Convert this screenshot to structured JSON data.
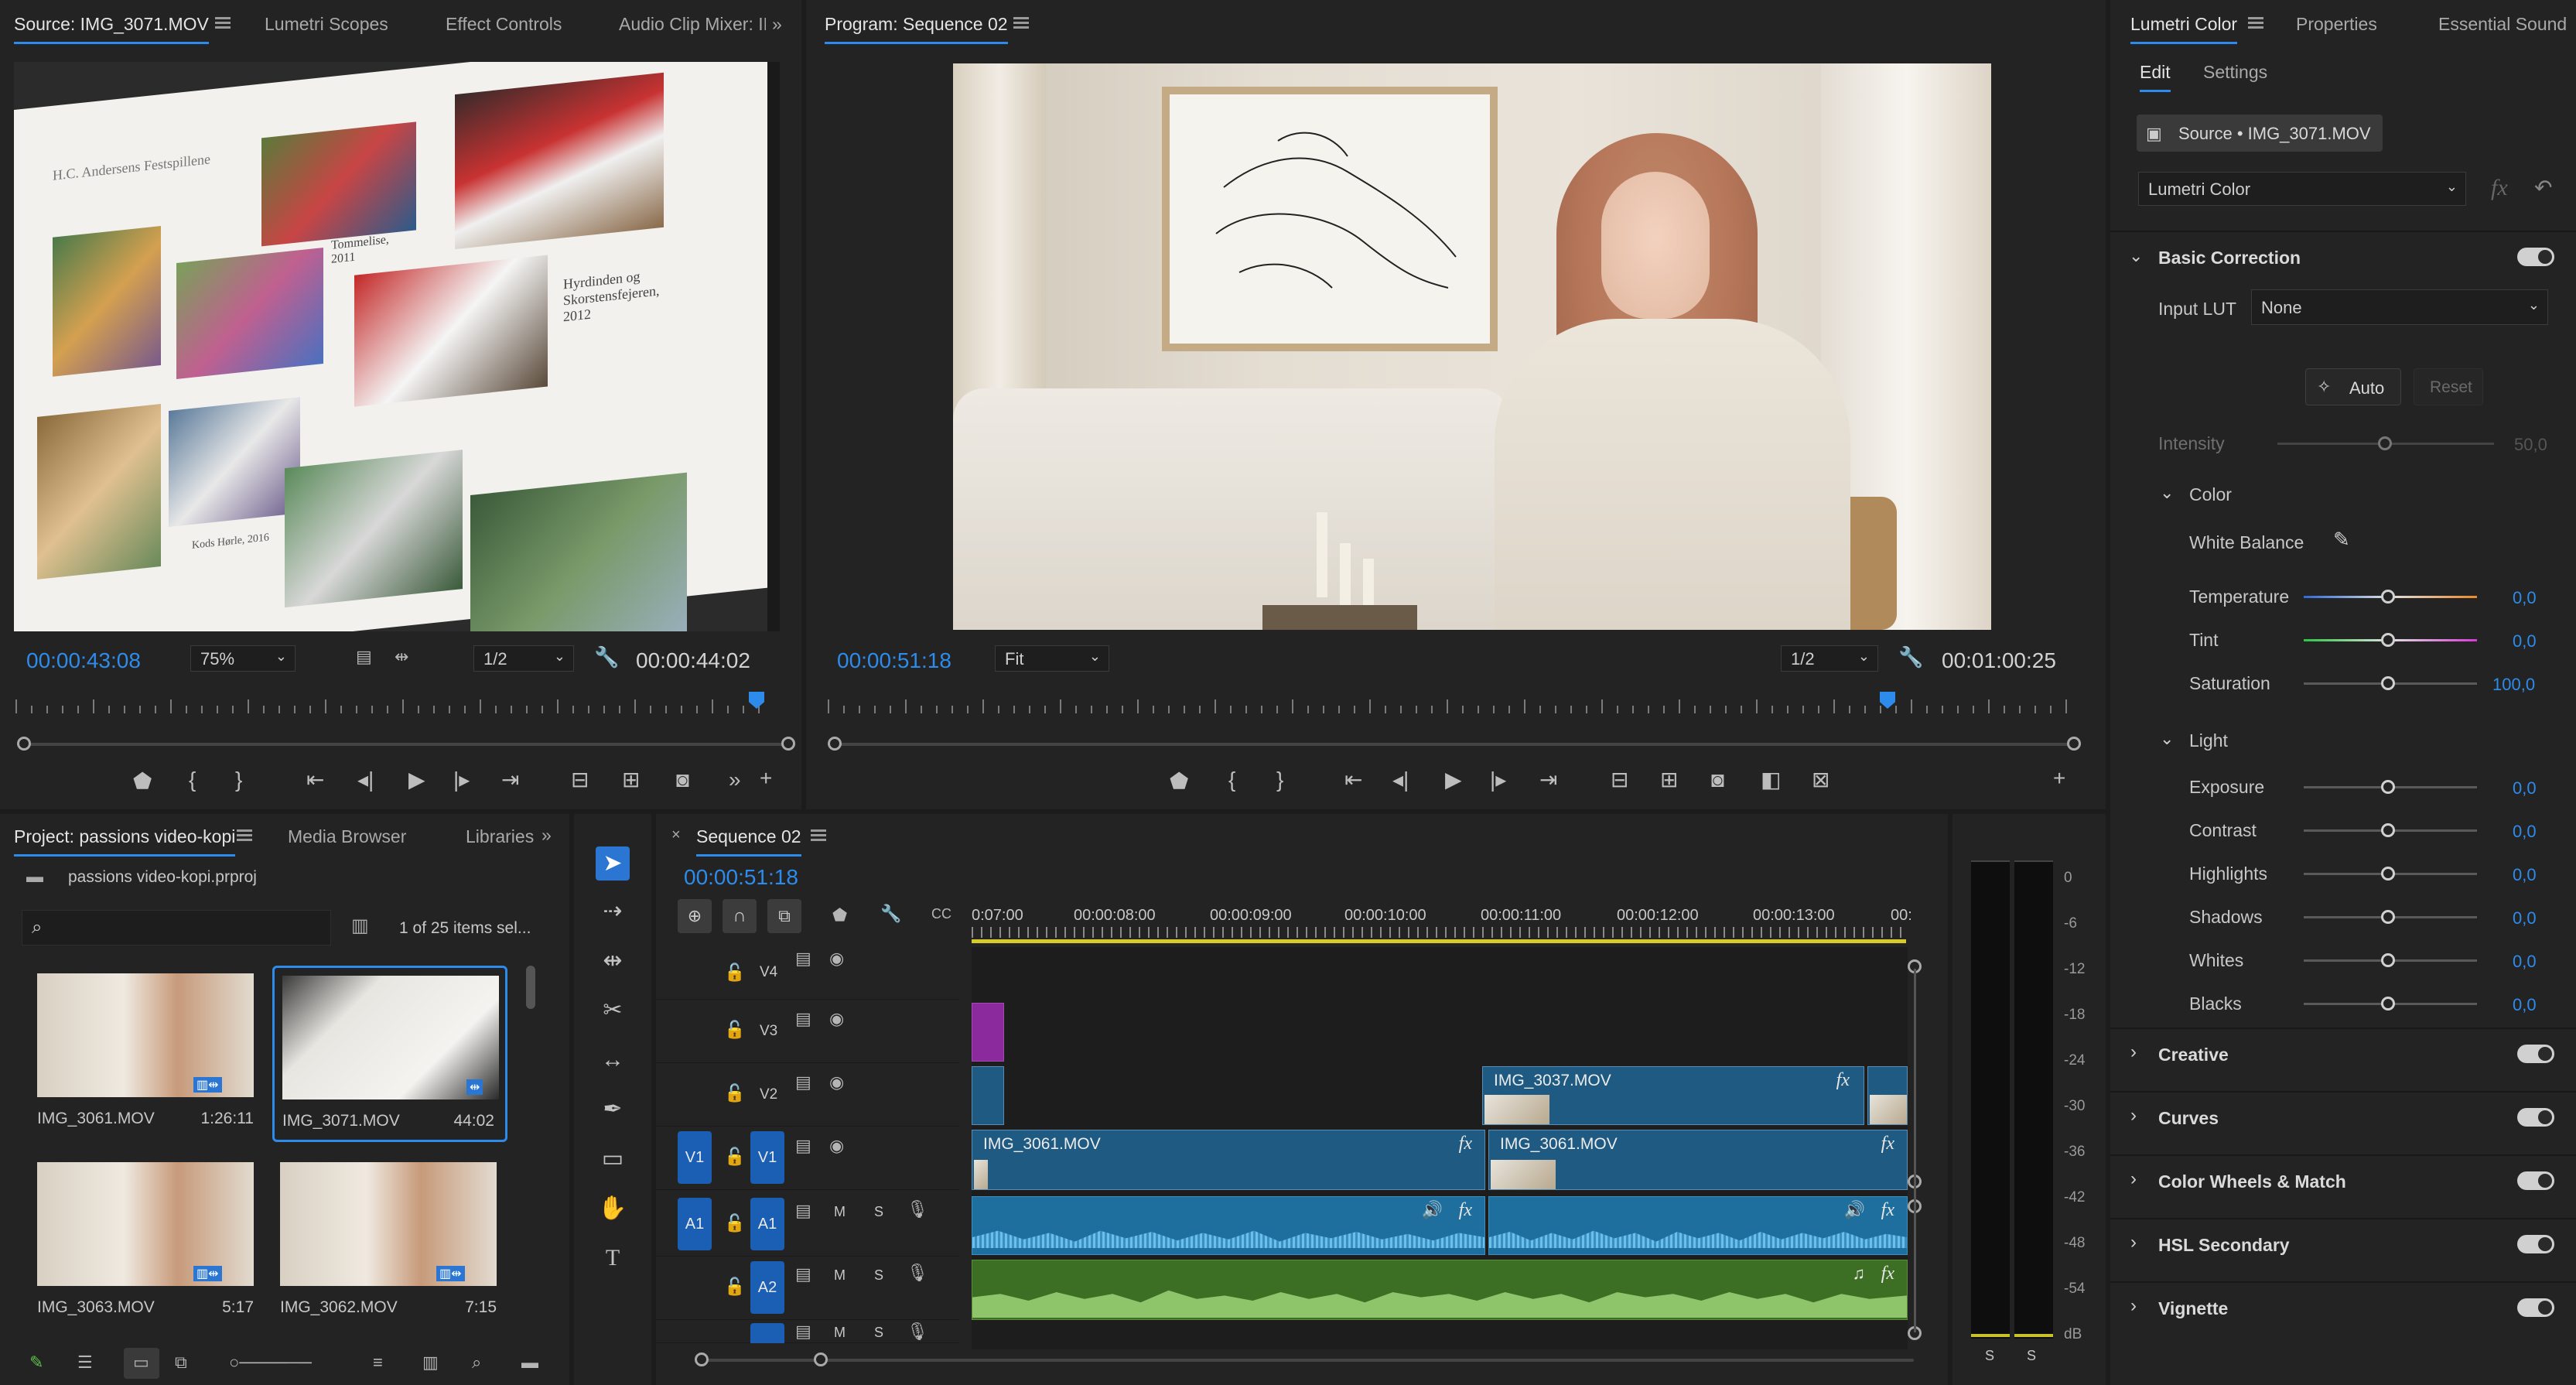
{
  "source_monitor": {
    "tabs": [
      "Source: IMG_3071.MOV",
      "Lumetri Scopes",
      "Effect Controls",
      "Audio Clip Mixer: IN"
    ],
    "timecode_left": "00:00:43:08",
    "zoom": "75%",
    "resolution": "1/2",
    "timecode_right": "00:00:44:02",
    "frame_text": {
      "title": "H.C. Andersens Festspillene",
      "caption1": "Tommelise, 2011",
      "caption2": "Hyrdinden og Skorstensfejeren, 2012",
      "caption3": "Kods Hørle, 2016"
    }
  },
  "program_monitor": {
    "tab": "Program: Sequence 02",
    "timecode_left": "00:00:51:18",
    "fit": "Fit",
    "resolution": "1/2",
    "timecode_right": "00:01:00:25"
  },
  "lumetri": {
    "tabs": [
      "Lumetri Color",
      "Properties",
      "Essential Sound"
    ],
    "subtabs": [
      "Edit",
      "Settings"
    ],
    "source_label": "Source • IMG_3071.MOV",
    "effect_dropdown": "Lumetri Color",
    "basic_correction": "Basic Correction",
    "input_lut_label": "Input LUT",
    "input_lut_value": "None",
    "auto_label": "Auto",
    "reset_label": "Reset",
    "intensity_label": "Intensity",
    "intensity_value": "50,0",
    "color_label": "Color",
    "white_balance_label": "White Balance",
    "color_params": [
      {
        "label": "Temperature",
        "value": "0,0",
        "level": 0.5
      },
      {
        "label": "Tint",
        "value": "0,0",
        "level": 0.5
      },
      {
        "label": "Saturation",
        "value": "100,0",
        "level": 0.5
      }
    ],
    "light_label": "Light",
    "light_params": [
      {
        "label": "Exposure",
        "value": "0,0",
        "level": 0.5
      },
      {
        "label": "Contrast",
        "value": "0,0",
        "level": 0.5
      },
      {
        "label": "Highlights",
        "value": "0,0",
        "level": 0.5
      },
      {
        "label": "Shadows",
        "value": "0,0",
        "level": 0.5
      },
      {
        "label": "Whites",
        "value": "0,0",
        "level": 0.5
      },
      {
        "label": "Blacks",
        "value": "0,0",
        "level": 0.5
      }
    ],
    "sections": [
      "Creative",
      "Curves",
      "Color Wheels & Match",
      "HSL Secondary",
      "Vignette"
    ]
  },
  "project": {
    "tabs": [
      "Project: passions video-kopi",
      "Media Browser",
      "Libraries"
    ],
    "project_file": "passions video-kopi.prproj",
    "selection_info": "1 of 25 items sel...",
    "items": [
      {
        "name": "IMG_3061.MOV",
        "duration": "1:26:11"
      },
      {
        "name": "IMG_3071.MOV",
        "duration": "44:02"
      },
      {
        "name": "IMG_3063.MOV",
        "duration": "5:17"
      },
      {
        "name": "IMG_3062.MOV",
        "duration": "7:15"
      }
    ]
  },
  "timeline": {
    "tab": "Sequence 02",
    "timecode": "00:00:51:18",
    "ruler_labels": [
      "0:07:00",
      "00:00:08:00",
      "00:00:09:00",
      "00:00:10:00",
      "00:00:11:00",
      "00:00:12:00",
      "00:00:13:00",
      "00:"
    ],
    "tracks": {
      "v4": "V4",
      "v3": "V3",
      "v2": "V2",
      "v1": "V1",
      "a1": "A1",
      "a2": "A2",
      "src_v1": "V1",
      "src_a1": "A1",
      "m": "M",
      "s": "S"
    },
    "clips": {
      "v2_clip": "IMG_3037.MOV",
      "v1_clip_a": "IMG_3061.MOV",
      "v1_clip_b": "IMG_3061.MOV",
      "fx": "fx"
    }
  },
  "meter": {
    "scale": [
      "0",
      "-6",
      "-12",
      "-18",
      "-24",
      "-30",
      "-36",
      "-42",
      "-48",
      "-54",
      "dB"
    ],
    "channels": [
      "S",
      "S"
    ]
  },
  "colors": {
    "accent": "#2d8ceb",
    "video_clip": "#1f5a82",
    "audio_clip_blue": "#1e6f9e",
    "audio_clip_green": "#3c6e24",
    "purple_clip": "#8a2a9c",
    "playhead_bar": "#d6cd2b"
  }
}
